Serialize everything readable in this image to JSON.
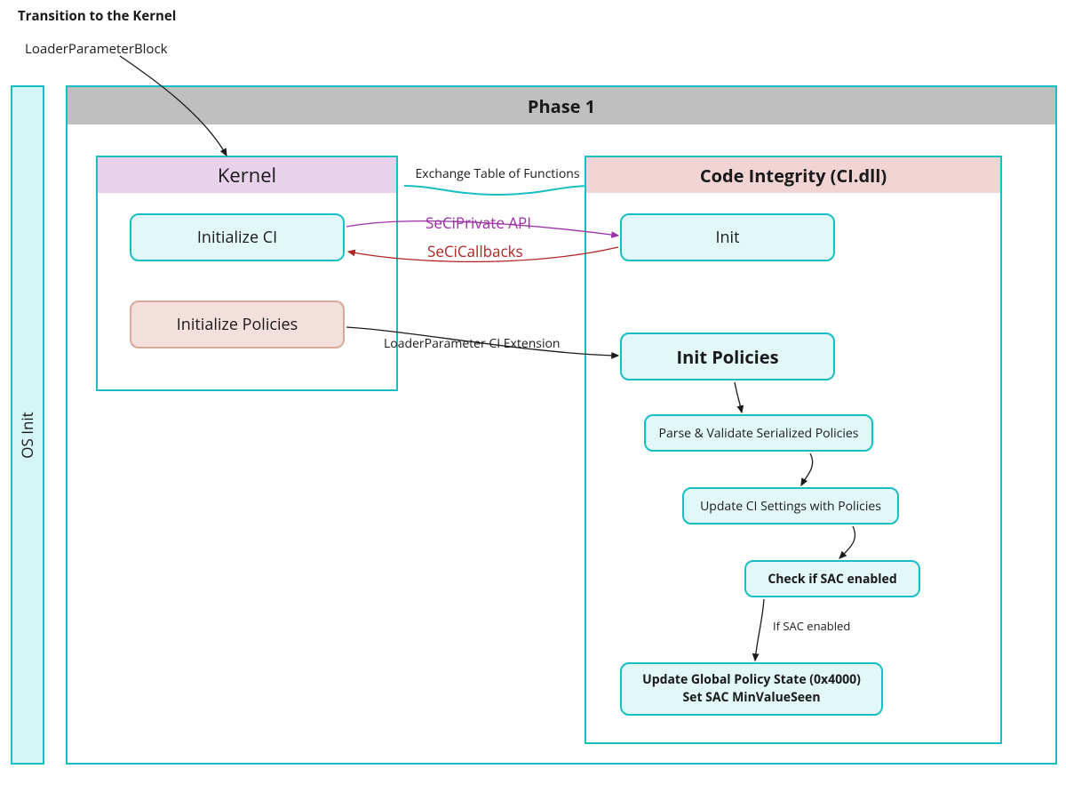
{
  "title": "Transition to the Kernel",
  "loader_label": "LoaderParameterBlock",
  "os_init": "OS Init",
  "phase_header": "Phase 1",
  "kernel": {
    "header": "Kernel",
    "init_ci": "Initialize CI",
    "init_policies": "Initialize Policies"
  },
  "exchange_label": "Exchange Table of Functions",
  "arrows": {
    "seci_private": "SeCiPrivate API",
    "seci_callbacks": "SeCiCallbacks",
    "loader_ci_ext": "LoaderParameter CI Extension",
    "if_sac": "If SAC enabled"
  },
  "ci": {
    "header": "Code Integrity (CI.dll)",
    "init": "Init",
    "init_policies": "Init Policies",
    "parse": "Parse & Validate Serialized Policies",
    "update_settings": "Update CI Settings with Policies",
    "check_sac": "Check if SAC enabled",
    "update_global_1": "Update Global Policy State (0x4000)",
    "update_global_2": "Set SAC MinValueSeen"
  }
}
